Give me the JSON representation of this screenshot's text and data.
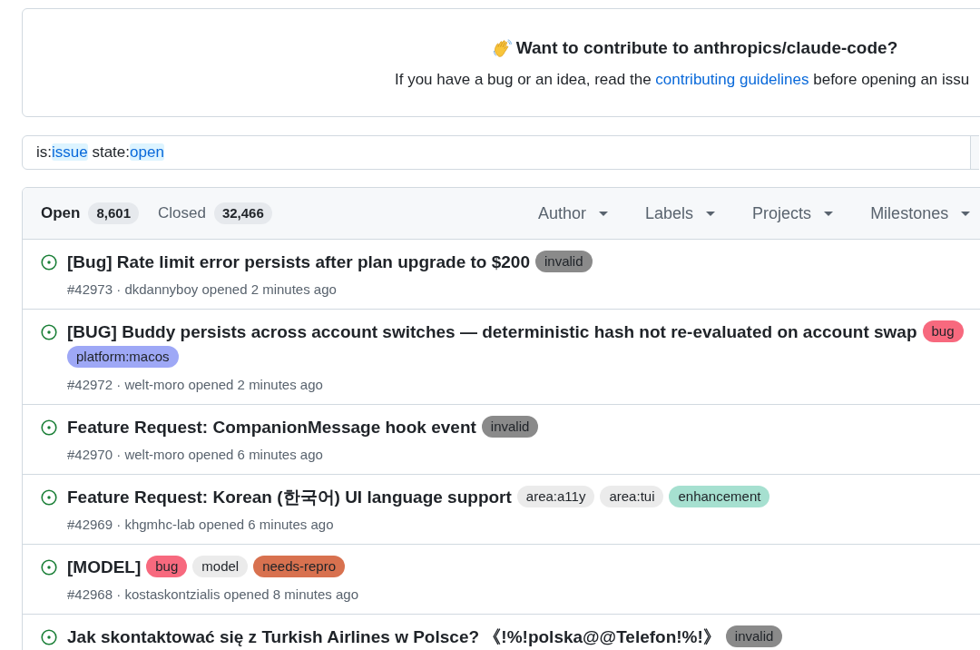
{
  "banner": {
    "title": "Want to contribute to anthropics/claude-code?",
    "text_before": "If you have a bug or an idea, read the ",
    "link": "contributing guidelines",
    "text_after": " before opening an issu"
  },
  "search": {
    "tokens": [
      {
        "qualifier": "is:",
        "value": "issue"
      },
      {
        "qualifier": "state:",
        "value": "open"
      }
    ]
  },
  "tabs": [
    {
      "label": "Open",
      "count": "8,601",
      "selected": true
    },
    {
      "label": "Closed",
      "count": "32,466",
      "selected": false
    }
  ],
  "filters": [
    "Author",
    "Labels",
    "Projects",
    "Milestones"
  ],
  "issues": [
    {
      "title": "[Bug] Rate limit error persists after plan upgrade to $200",
      "labels": [
        {
          "name": "invalid",
          "color": "#8a8a8a"
        }
      ],
      "meta": "#42973 · dkdannyboy opened 2 minutes ago"
    },
    {
      "title": "[BUG] Buddy persists across account switches — deterministic hash not re-evaluated on account swap",
      "labels": [
        {
          "name": "bug",
          "color": "#f7697e"
        },
        {
          "name": "platform:macos",
          "color": "#9ea8f6"
        }
      ],
      "meta": "#42972 · welt-moro opened 2 minutes ago"
    },
    {
      "title": "Feature Request: CompanionMessage hook event",
      "labels": [
        {
          "name": "invalid",
          "color": "#8a8a8a"
        }
      ],
      "meta": "#42970 · welt-moro opened 6 minutes ago"
    },
    {
      "title": "Feature Request: Korean (한국어) UI language support",
      "labels": [
        {
          "name": "area:a11y",
          "color": "#ebebeb"
        },
        {
          "name": "area:tui",
          "color": "#ebebeb"
        },
        {
          "name": "enhancement",
          "color": "#a6e0d0"
        }
      ],
      "meta": "#42969 · khgmhc-lab opened 6 minutes ago"
    },
    {
      "title": "[MODEL]",
      "labels": [
        {
          "name": "bug",
          "color": "#f7697e"
        },
        {
          "name": "model",
          "color": "#ebebeb"
        },
        {
          "name": "needs-repro",
          "color": "#d8714f"
        }
      ],
      "meta": "#42968 · kostaskontzialis opened 8 minutes ago"
    },
    {
      "title": "Jak skontaktować się z Turkish Airlines w Polsce? 《!%!polska@@Telefon!%!》",
      "labels": [
        {
          "name": "invalid",
          "color": "#8a8a8a"
        }
      ]
    }
  ]
}
